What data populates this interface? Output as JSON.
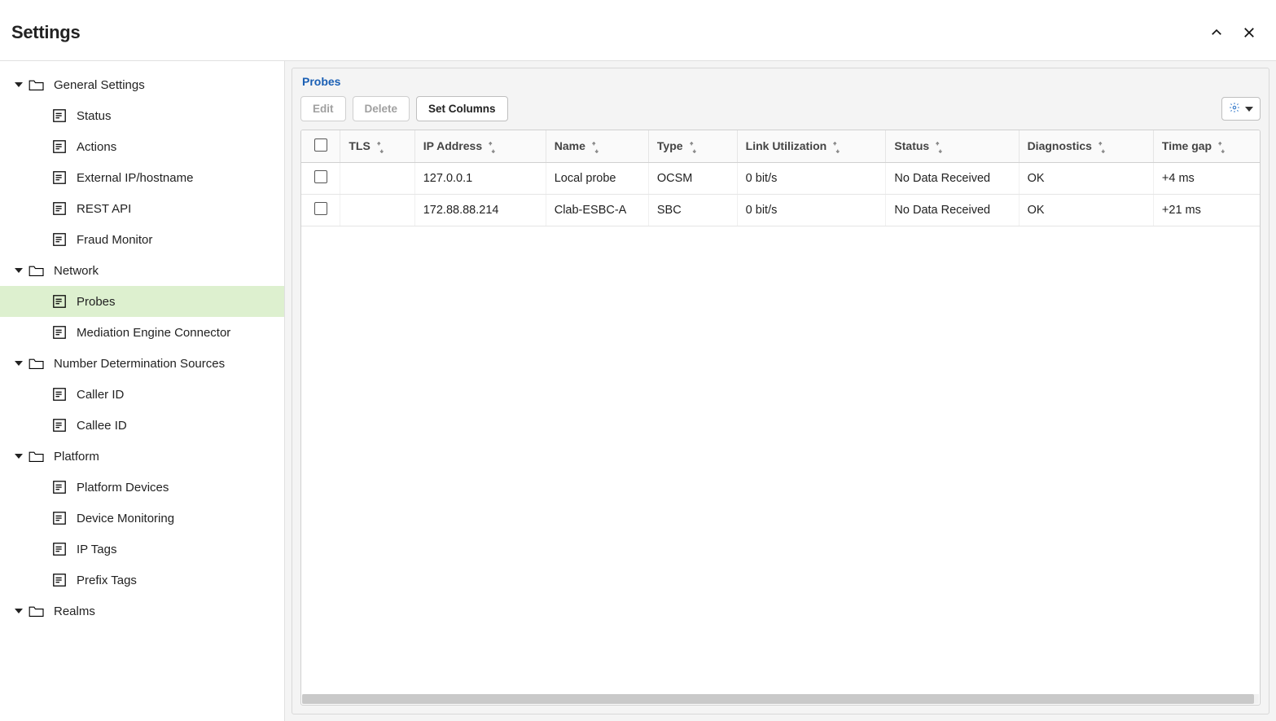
{
  "header": {
    "title": "Settings"
  },
  "sidebar": {
    "groups": [
      {
        "label": "General Settings",
        "items": [
          {
            "label": "Status"
          },
          {
            "label": "Actions"
          },
          {
            "label": "External IP/hostname"
          },
          {
            "label": "REST API"
          },
          {
            "label": "Fraud Monitor"
          }
        ]
      },
      {
        "label": "Network",
        "items": [
          {
            "label": "Probes",
            "selected": true
          },
          {
            "label": "Mediation Engine Connector"
          }
        ]
      },
      {
        "label": "Number Determination Sources",
        "items": [
          {
            "label": "Caller ID"
          },
          {
            "label": "Callee ID"
          }
        ]
      },
      {
        "label": "Platform",
        "items": [
          {
            "label": "Platform Devices"
          },
          {
            "label": "Device Monitoring"
          },
          {
            "label": "IP Tags"
          },
          {
            "label": "Prefix Tags"
          }
        ]
      },
      {
        "label": "Realms",
        "items": []
      }
    ]
  },
  "panel": {
    "title": "Probes",
    "toolbar": {
      "edit": "Edit",
      "delete": "Delete",
      "set_columns": "Set Columns"
    },
    "columns": {
      "tls": "TLS",
      "ip": "IP Address",
      "name": "Name",
      "type": "Type",
      "link": "Link Utilization",
      "status": "Status",
      "diag": "Diagnostics",
      "gap": "Time gap"
    },
    "rows": [
      {
        "tls": "",
        "ip": "127.0.0.1",
        "name": "Local probe",
        "type": "OCSM",
        "link": "0 bit/s",
        "status": "No Data Received",
        "diag": "OK",
        "gap": "+4 ms"
      },
      {
        "tls": "",
        "ip": "172.88.88.214",
        "name": "Clab-ESBC-A",
        "type": "SBC",
        "link": "0 bit/s",
        "status": "No Data Received",
        "diag": "OK",
        "gap": "+21 ms"
      }
    ]
  }
}
